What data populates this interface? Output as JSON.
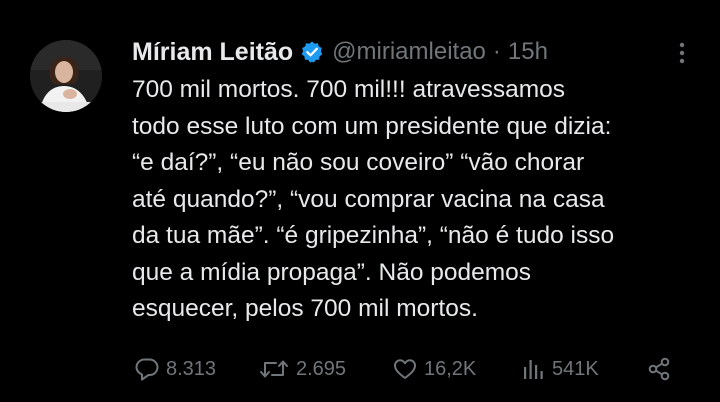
{
  "tweet": {
    "author_name": "Míriam Leitão",
    "handle": "@miriamleitao",
    "separator": "·",
    "time": "15h",
    "verified": true,
    "text": "700 mil mortos. 700 mil!!! atravessamos\ntodo esse luto com um presidente que dizia:\n“e daí?”, “eu não sou coveiro” “vão chorar\naté quando?”, “vou comprar vacina na casa\nda tua mãe”. “é gripezinha”, “não é tudo isso\nque a mídia propaga”. Não podemos\nesquecer, pelos 700 mil mortos."
  },
  "actions": {
    "replies": "8.313",
    "retweets": "2.695",
    "likes": "16,2K",
    "views": "541K"
  },
  "icons": {
    "avatar": "avatar-photo",
    "verified": "verified-badge-icon",
    "more": "more-options-icon",
    "reply": "reply-icon",
    "retweet": "retweet-icon",
    "like": "heart-icon",
    "views": "views-chart-icon",
    "share": "share-icon"
  },
  "colors": {
    "background": "#000000",
    "text": "#e7e9ea",
    "muted": "#71767b",
    "verified": "#1d9bf0"
  }
}
